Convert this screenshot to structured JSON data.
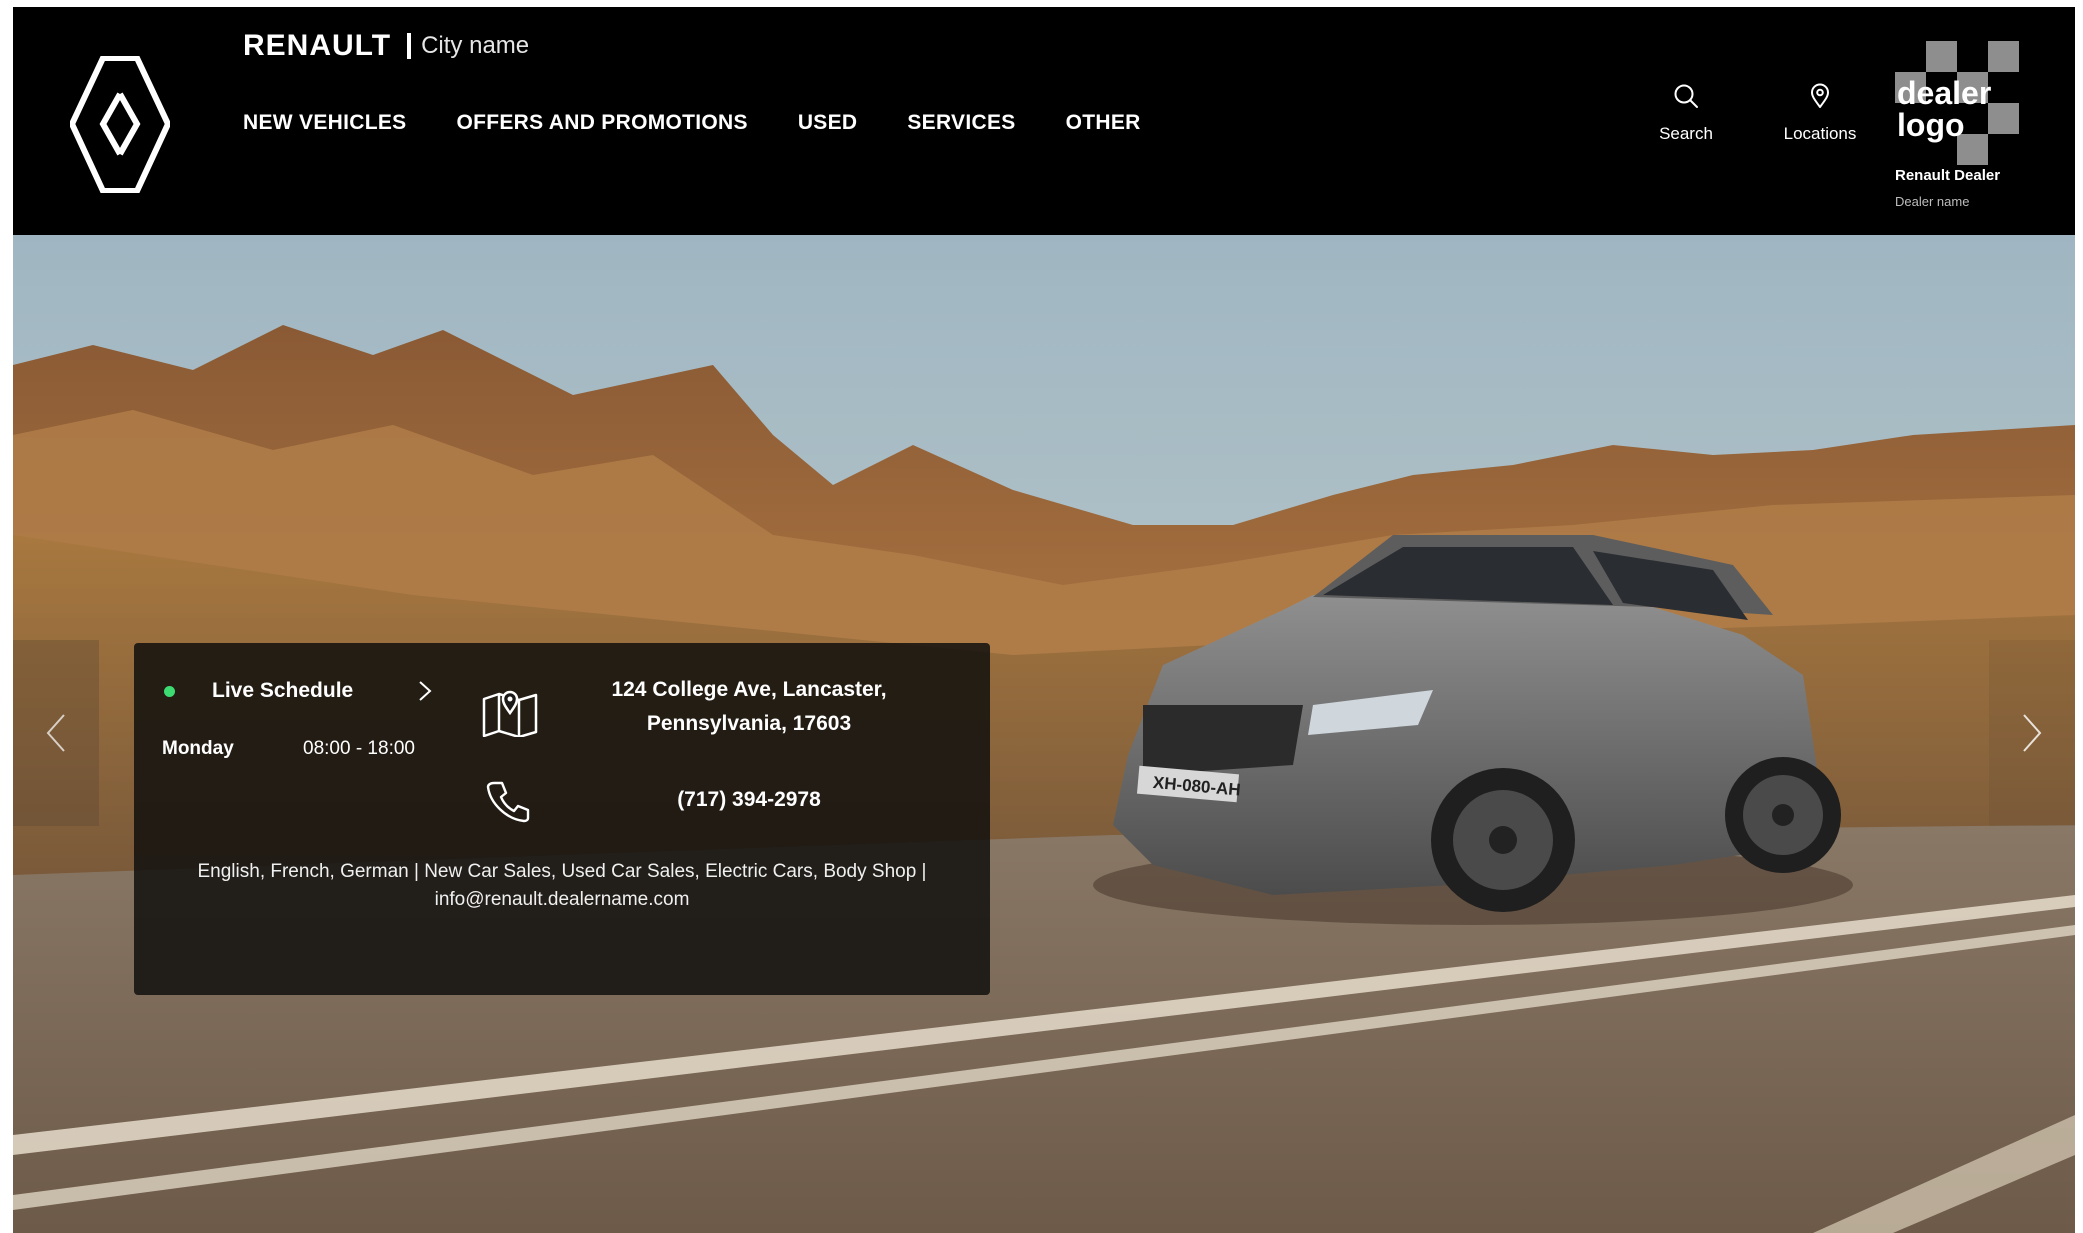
{
  "header": {
    "brand": "RENAULT",
    "city": "City name",
    "logo_icon": "renault-diamond-logo",
    "nav": [
      {
        "label": "NEW VEHICLES"
      },
      {
        "label": "OFFERS AND PROMOTIONS"
      },
      {
        "label": "USED"
      },
      {
        "label": "SERVICES"
      },
      {
        "label": "OTHER"
      }
    ],
    "tools": {
      "search": {
        "label": "Search",
        "icon": "search-icon"
      },
      "locations": {
        "label": "Locations",
        "icon": "location-pin-icon"
      }
    },
    "dealer": {
      "logo_text": "dealer logo",
      "title": "Renault Dealer",
      "name": "Dealer name"
    }
  },
  "hero": {
    "plate": "XH-080-AH",
    "info_card": {
      "status_color": "#3ddc73",
      "live_label": "Live Schedule",
      "day": "Monday",
      "hours": "08:00 - 18:00",
      "address_line1": "124 College Ave, Lancaster,",
      "address_line2": "Pennsylvania, 17603",
      "phone": "(717) 394-2978",
      "services_line1": "English, French, German | New Car Sales, Used Car Sales, Electric Cars, Body Shop |",
      "services_line2": "info@renault.dealername.com"
    }
  },
  "colors": {
    "header_bg": "#000000",
    "accent_green": "#3ddc73"
  }
}
